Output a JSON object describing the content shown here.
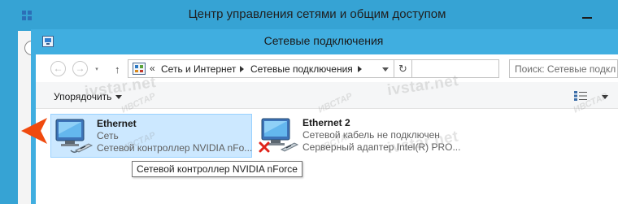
{
  "back_window": {
    "title": "Центр управления сетями и общим доступом"
  },
  "window": {
    "title": "Сетевые подключения"
  },
  "address_bar": {
    "prefix": "«",
    "crumbs": [
      "Сеть и Интернет",
      "Сетевые подключения"
    ]
  },
  "search": {
    "placeholder": "Поиск: Сетевые подключения"
  },
  "toolbar": {
    "organize_label": "Упорядочить"
  },
  "connections": [
    {
      "name": "Ethernet",
      "status": "Сеть",
      "adapter": "Сетевой контроллер NVIDIA nForce",
      "adapter_visible": "Сетевой контроллер NVIDIA nFo...",
      "selected": true,
      "disconnected": false
    },
    {
      "name": "Ethernet 2",
      "status": "Сетевой кабель не подключен",
      "adapter": "Серверный адаптер Intel(R) PRO...",
      "selected": false,
      "disconnected": true
    }
  ],
  "tooltip": {
    "text": "Сетевой контроллер NVIDIA nForce"
  },
  "colors": {
    "window_frame": "#40aee0",
    "selection_fill": "#cce8ff",
    "selection_border": "#99d1ff",
    "pointer_arrow": "#f04a0e",
    "disconnected_x": "#e0231a"
  }
}
